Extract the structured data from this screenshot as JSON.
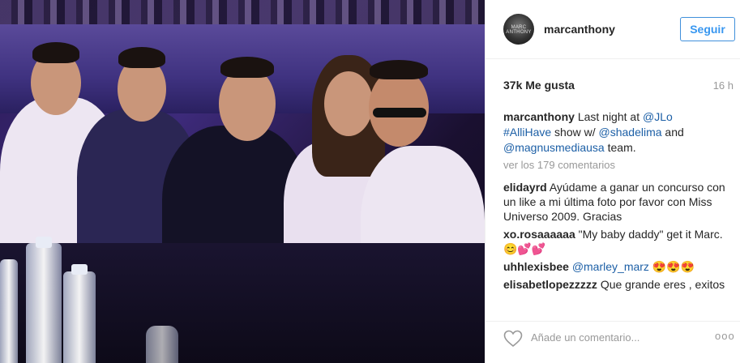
{
  "header": {
    "username": "marcanthony",
    "avatar_text": "MARC ANTHONY",
    "follow_label": "Seguir"
  },
  "stats": {
    "likes": "37k Me gusta",
    "time_ago": "16 h"
  },
  "caption": {
    "username": "marcanthony",
    "text1": "Last night at",
    "mention1": "@JLo",
    "hashtag": "#AlliHave",
    "text2": "show w/",
    "mention2": "@shadelima",
    "text3": "and",
    "mention3": "@magnusmediausa",
    "text4": "team."
  },
  "view_all": "ver los 179 comentarios",
  "comments": [
    {
      "user": "elidayrd",
      "text": "Ayúdame a ganar un concurso con un like a mi última foto por favor con Miss Universo 2009. Gracias"
    },
    {
      "user": "xo.rosaaaaaa",
      "text": "\"My baby daddy\" get it Marc. 😊💕💕"
    },
    {
      "user": "uhhlexisbee",
      "mention": "@marley_marz",
      "text": "😍😍😍"
    },
    {
      "user": "elisabetlopezzzzz",
      "text": "Que grande eres , exitos"
    }
  ],
  "footer": {
    "add_comment_placeholder": "Añade un comentario...",
    "more_label": "ooo"
  },
  "colors": {
    "link": "#1c5fa6",
    "follow": "#3897f0",
    "muted": "#999999"
  },
  "icons": {
    "like": "heart-outline-icon",
    "options": "more-options-icon"
  }
}
